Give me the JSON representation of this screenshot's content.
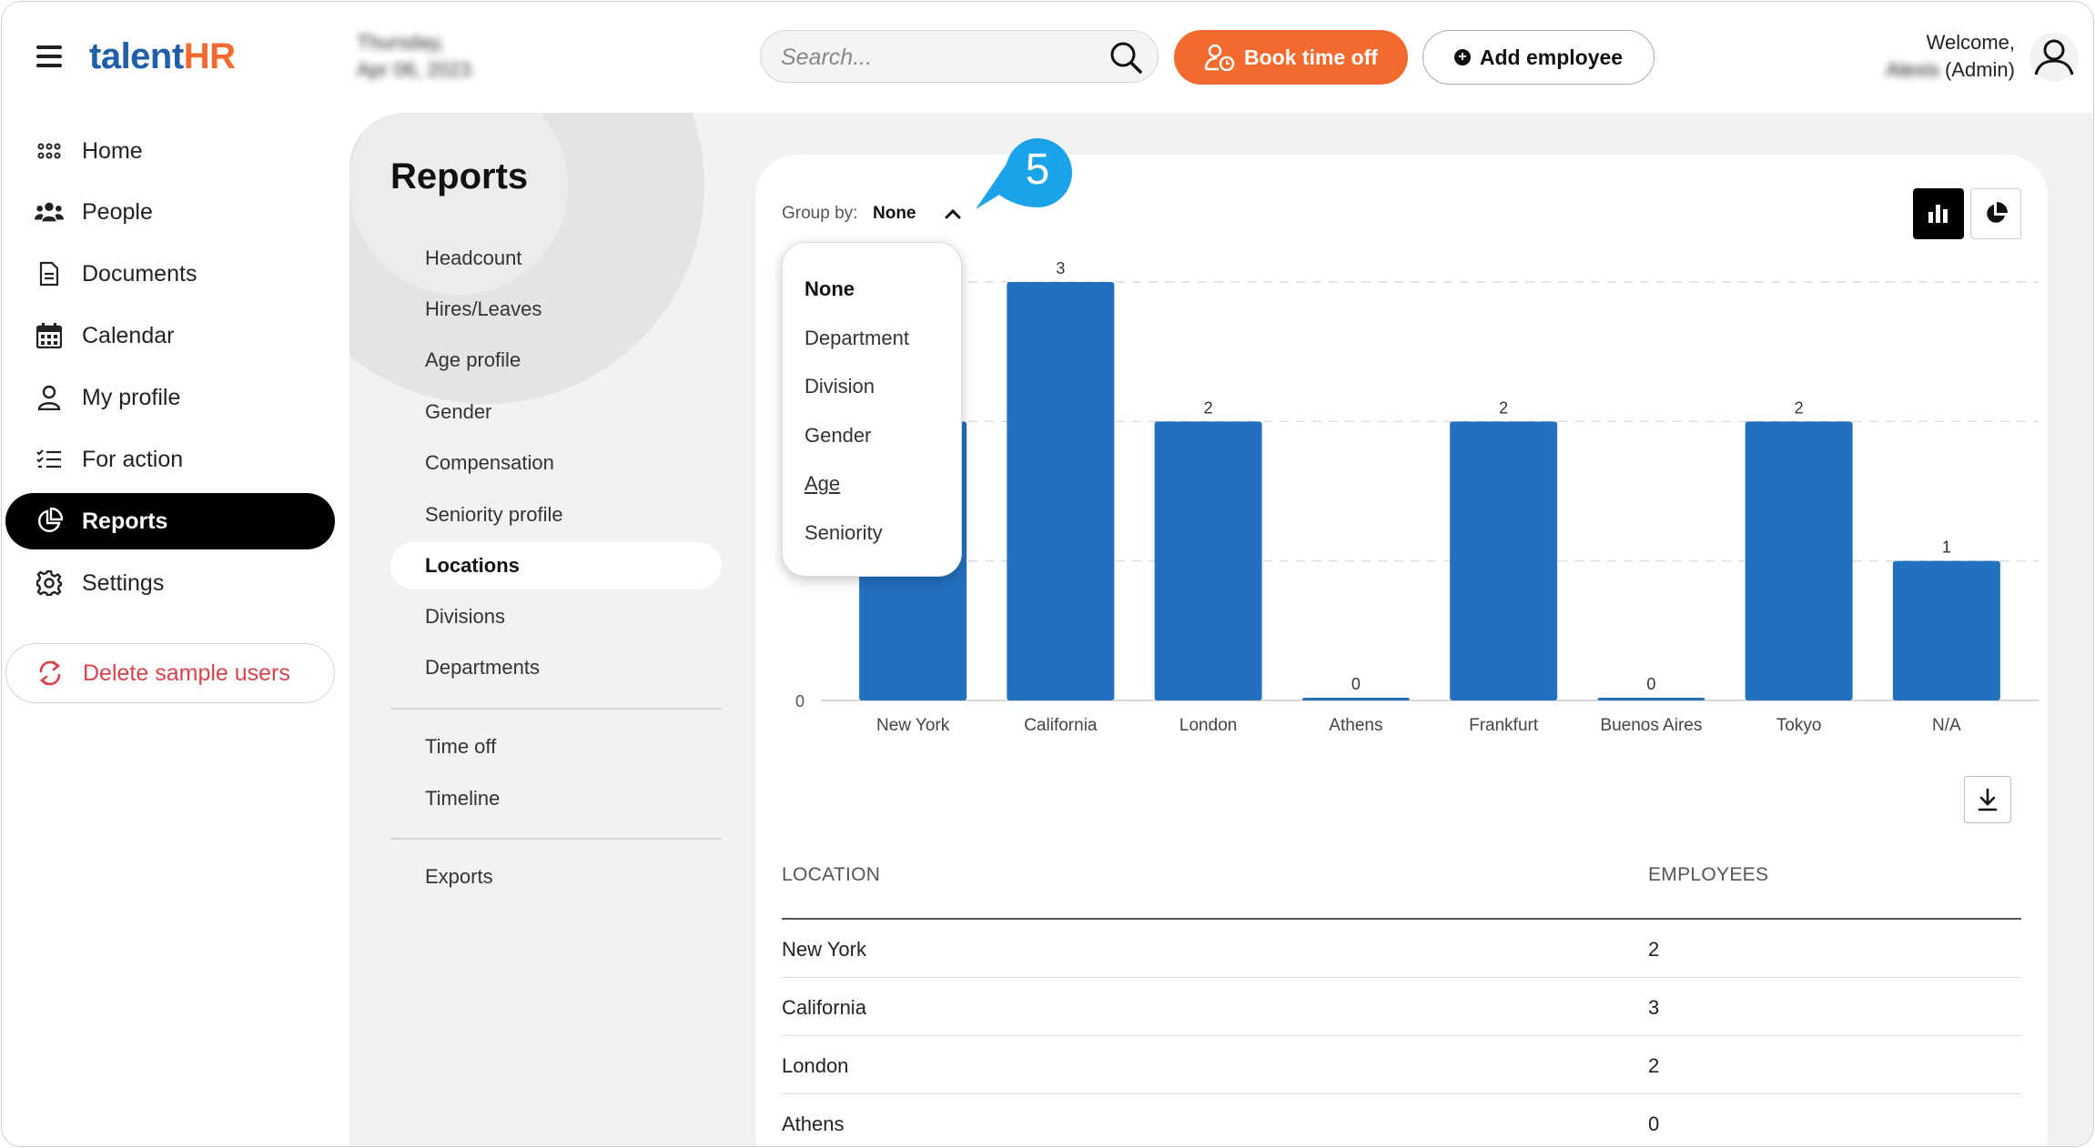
{
  "header": {
    "logo_part1": "talent",
    "logo_part2": "HR",
    "date_line1": "Thursday,",
    "date_line2": "Apr 06, 2023",
    "search_placeholder": "Search...",
    "book_label": "Book time off",
    "add_label": "Add employee",
    "welcome": "Welcome,",
    "user_name": "Alexis",
    "user_role": "(Admin)"
  },
  "sidebar": {
    "items": [
      {
        "label": "Home",
        "icon": "grid-icon"
      },
      {
        "label": "People",
        "icon": "people-icon"
      },
      {
        "label": "Documents",
        "icon": "document-icon"
      },
      {
        "label": "Calendar",
        "icon": "calendar-icon"
      },
      {
        "label": "My profile",
        "icon": "user-icon"
      },
      {
        "label": "For action",
        "icon": "checklist-icon"
      },
      {
        "label": "Reports",
        "icon": "pie-chart-icon",
        "active": true
      },
      {
        "label": "Settings",
        "icon": "gear-icon"
      }
    ],
    "delete_label": "Delete sample users"
  },
  "reports": {
    "title": "Reports",
    "links": [
      "Headcount",
      "Hires/Leaves",
      "Age profile",
      "Gender",
      "Compensation",
      "Seniority profile",
      "Locations",
      "Divisions",
      "Departments",
      "Time off",
      "Timeline",
      "Exports"
    ],
    "active": "Locations"
  },
  "card": {
    "group_label": "Group by:",
    "group_value": "None",
    "step_badge": "5",
    "dropdown_options": [
      "None",
      "Department",
      "Division",
      "Gender",
      "Age",
      "Seniority"
    ],
    "dropdown_selected": "None",
    "dropdown_hover": "Age"
  },
  "chart_data": {
    "type": "bar",
    "categories": [
      "New York",
      "California",
      "London",
      "Athens",
      "Frankfurt",
      "Buenos Aires",
      "Tokyo",
      "N/A"
    ],
    "values": [
      2,
      3,
      2,
      0,
      2,
      0,
      2,
      1
    ],
    "ylim": [
      0,
      3
    ],
    "yticks": [
      "0"
    ],
    "grid": true,
    "bar_color": "#2370bf"
  },
  "table": {
    "headers": [
      "LOCATION",
      "EMPLOYEES"
    ],
    "rows": [
      [
        "New York",
        "2"
      ],
      [
        "California",
        "3"
      ],
      [
        "London",
        "2"
      ],
      [
        "Athens",
        "0"
      ]
    ]
  },
  "colors": {
    "accent_orange": "#f26a2e",
    "logo_blue": "#1f5ea8",
    "badge_blue": "#1aa3e8",
    "delete_red": "#d8434b"
  }
}
